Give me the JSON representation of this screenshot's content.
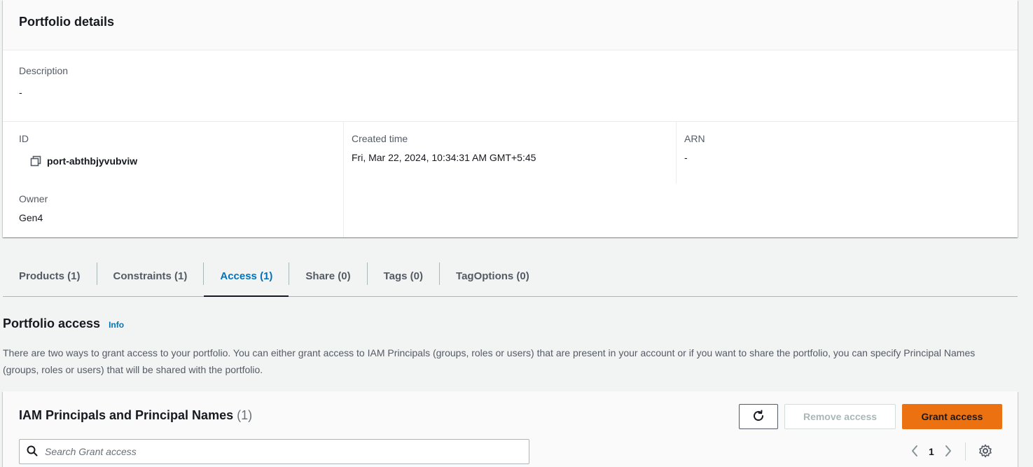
{
  "details": {
    "title": "Portfolio details",
    "description_label": "Description",
    "description_value": "-",
    "id_label": "ID",
    "id_value": "port-abthbjyvubviw",
    "created_label": "Created time",
    "created_value": "Fri, Mar 22, 2024, 10:34:31 AM GMT+5:45",
    "arn_label": "ARN",
    "arn_value": "-",
    "owner_label": "Owner",
    "owner_value": "Gen4"
  },
  "tabs": [
    {
      "label": "Products (1)",
      "active": false
    },
    {
      "label": "Constraints (1)",
      "active": false
    },
    {
      "label": "Access (1)",
      "active": true
    },
    {
      "label": "Share (0)",
      "active": false
    },
    {
      "label": "Tags (0)",
      "active": false
    },
    {
      "label": "TagOptions (0)",
      "active": false
    }
  ],
  "access": {
    "title": "Portfolio access",
    "info_label": "Info",
    "description": "There are two ways to grant access to your portfolio. You can either grant access to IAM Principals (groups, roles or users) that are present in your account or if you want to share the portfolio, you can specify Principal Names (groups, roles or users) that will be shared with the portfolio."
  },
  "principals_table": {
    "title": "IAM Principals and Principal Names",
    "count": "(1)",
    "remove_label": "Remove access",
    "grant_label": "Grant access",
    "search_placeholder": "Search Grant access",
    "current_page": "1"
  },
  "icons": {
    "copy": "copy-icon",
    "refresh": "refresh-icon",
    "search": "search-icon",
    "prev": "chevron-left-icon",
    "next": "chevron-right-icon",
    "settings": "gear-icon"
  },
  "colors": {
    "accent": "#0073bb",
    "primary_button": "#ec7211"
  }
}
